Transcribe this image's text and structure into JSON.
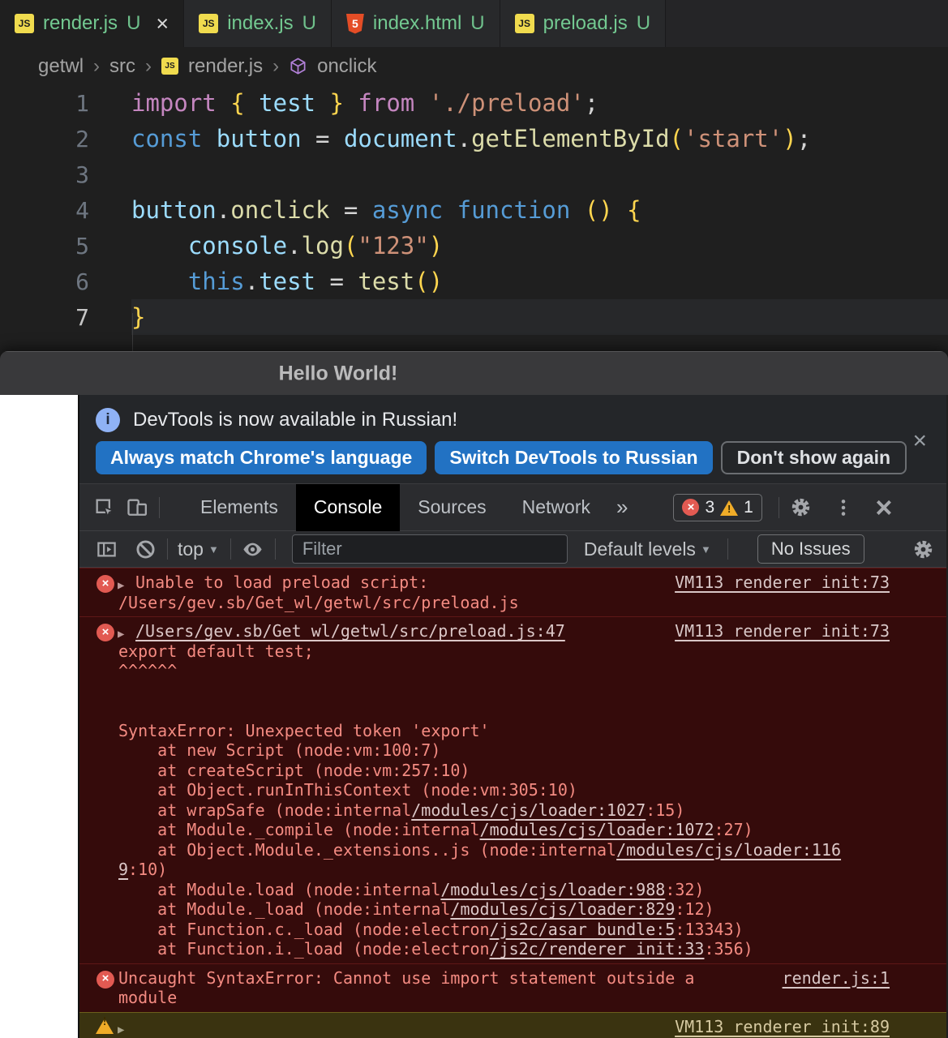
{
  "colors": {
    "accent_blue": "#2272c3",
    "error_red": "#e25a52",
    "warning_yellow": "#f0ac28",
    "git_green": "#73c991",
    "error_bg": "#350b0b",
    "warning_bg": "#3a3310"
  },
  "editor": {
    "tabs": [
      {
        "label": "render.js",
        "badge": "U",
        "icon": "js",
        "active": true
      },
      {
        "label": "index.js",
        "badge": "U",
        "icon": "js",
        "active": false
      },
      {
        "label": "index.html",
        "badge": "U",
        "icon": "html",
        "active": false
      },
      {
        "label": "preload.js",
        "badge": "U",
        "icon": "js",
        "active": false
      }
    ],
    "breadcrumb": [
      {
        "label": "getwl"
      },
      {
        "label": "src"
      },
      {
        "label": "render.js",
        "icon": "js"
      },
      {
        "label": "onclick",
        "icon": "symbol"
      }
    ],
    "lines": [
      {
        "num": "1",
        "tokens": [
          [
            "import",
            "kwp"
          ],
          [
            " ",
            "pn"
          ],
          [
            "{",
            "gd"
          ],
          [
            " ",
            "pn"
          ],
          [
            "test",
            "vr"
          ],
          [
            " ",
            "pn"
          ],
          [
            "}",
            "gd"
          ],
          [
            " ",
            "pn"
          ],
          [
            "from",
            "kwp"
          ],
          [
            " ",
            "pn"
          ],
          [
            "'./preload'",
            "st"
          ],
          [
            ";",
            "pn"
          ]
        ]
      },
      {
        "num": "2",
        "tokens": [
          [
            "const",
            "kwb"
          ],
          [
            " ",
            "pn"
          ],
          [
            "button",
            "vr"
          ],
          [
            " = ",
            "pn"
          ],
          [
            "document",
            "vr"
          ],
          [
            ".",
            "pn"
          ],
          [
            "getElementById",
            "fn"
          ],
          [
            "(",
            "gd"
          ],
          [
            "'start'",
            "st"
          ],
          [
            ")",
            "gd"
          ],
          [
            ";",
            "pn"
          ]
        ]
      },
      {
        "num": "3",
        "tokens": []
      },
      {
        "num": "4",
        "tokens": [
          [
            "button",
            "vr"
          ],
          [
            ".",
            "pn"
          ],
          [
            "onclick",
            "fn"
          ],
          [
            " = ",
            "pn"
          ],
          [
            "async",
            "kwb"
          ],
          [
            " ",
            "pn"
          ],
          [
            "function",
            "kwb"
          ],
          [
            " ",
            "pn"
          ],
          [
            "()",
            "gd"
          ],
          [
            " ",
            "pn"
          ],
          [
            "{",
            "gd"
          ]
        ]
      },
      {
        "num": "5",
        "tokens": [
          [
            "    ",
            "pn"
          ],
          [
            "console",
            "vr"
          ],
          [
            ".",
            "pn"
          ],
          [
            "log",
            "fn"
          ],
          [
            "(",
            "gd"
          ],
          [
            "\"123\"",
            "st"
          ],
          [
            ")",
            "gd"
          ]
        ]
      },
      {
        "num": "6",
        "tokens": [
          [
            "    ",
            "pn"
          ],
          [
            "this",
            "kwb"
          ],
          [
            ".",
            "pn"
          ],
          [
            "test",
            "vr"
          ],
          [
            " = ",
            "pn"
          ],
          [
            "test",
            "fn"
          ],
          [
            "()",
            "gd"
          ]
        ]
      },
      {
        "num": "7",
        "tokens": [
          [
            "}",
            "gd"
          ]
        ],
        "current": true
      }
    ]
  },
  "window": {
    "title": "Hello World!"
  },
  "devtools": {
    "notification": {
      "text": "DevTools is now available in Russian!",
      "buttons": [
        "Always match Chrome's language",
        "Switch DevTools to Russian",
        "Don't show again"
      ]
    },
    "main_tabs": [
      "Elements",
      "Console",
      "Sources",
      "Network"
    ],
    "active_tab": "Console",
    "error_count": "3",
    "warning_count": "1",
    "console_toolbar": {
      "context": "top",
      "filter_placeholder": "Filter",
      "levels": "Default levels",
      "no_issues": "No Issues"
    },
    "rows": [
      {
        "type": "error",
        "arrow": true,
        "right": "VM113 renderer_init:73",
        "lines": [
          [
            [
              "Unable to load preload script:",
              "e"
            ]
          ],
          [
            [
              "/Users/gev.sb/Get_wl/getwl/src/preload.js",
              "e"
            ]
          ]
        ]
      },
      {
        "type": "error",
        "arrow": true,
        "right": "VM113 renderer_init:73",
        "lines": [
          [
            [
              "/Users/gev.sb/Get_wl/getwl/src/preload.js:47",
              "l"
            ]
          ],
          [
            [
              "export default test;",
              "e"
            ]
          ],
          [
            [
              "^^^^^^",
              "e"
            ]
          ],
          [
            [
              " ",
              "e"
            ]
          ],
          [
            [
              " ",
              "e"
            ]
          ],
          [
            [
              "SyntaxError: Unexpected token 'export'",
              "e"
            ]
          ],
          [
            [
              "    at new Script (node:vm:100:7)",
              "e"
            ]
          ],
          [
            [
              "    at createScript (node:vm:257:10)",
              "e"
            ]
          ],
          [
            [
              "    at Object.runInThisContext (node:vm:305:10)",
              "e"
            ]
          ],
          [
            [
              "    at wrapSafe (node:internal",
              "e"
            ],
            [
              "/modules/cjs/loader:1027",
              "l"
            ],
            [
              ":15)",
              "e"
            ]
          ],
          [
            [
              "    at Module._compile (node:internal",
              "e"
            ],
            [
              "/modules/cjs/loader:1072",
              "l"
            ],
            [
              ":27)",
              "e"
            ]
          ],
          [
            [
              "    at Object.Module._extensions..js (node:internal",
              "e"
            ],
            [
              "/modules/cjs/loader:116",
              "l"
            ]
          ],
          [
            [
              "9",
              "l"
            ],
            [
              ":10)",
              "e"
            ]
          ],
          [
            [
              "    at Module.load (node:internal",
              "e"
            ],
            [
              "/modules/cjs/loader:988",
              "l"
            ],
            [
              ":32)",
              "e"
            ]
          ],
          [
            [
              "    at Module._load (node:internal",
              "e"
            ],
            [
              "/modules/cjs/loader:829",
              "l"
            ],
            [
              ":12)",
              "e"
            ]
          ],
          [
            [
              "    at Function.c._load (node:electron",
              "e"
            ],
            [
              "/js2c/asar_bundle:5",
              "l"
            ],
            [
              ":13343)",
              "e"
            ]
          ],
          [
            [
              "    at Function.i._load (node:electron",
              "e"
            ],
            [
              "/js2c/renderer_init:33",
              "l"
            ],
            [
              ":356)",
              "e"
            ]
          ]
        ]
      },
      {
        "type": "error",
        "arrow": false,
        "right": "render.js:1",
        "lines": [
          [
            [
              "Uncaught SyntaxError: Cannot use import statement outside a",
              "e"
            ]
          ],
          [
            [
              "module",
              "e"
            ]
          ]
        ]
      },
      {
        "type": "warning",
        "arrow": true,
        "right": "VM113 renderer_init:89",
        "lines": [
          [
            [
              " ",
              "w"
            ]
          ]
        ]
      }
    ]
  }
}
